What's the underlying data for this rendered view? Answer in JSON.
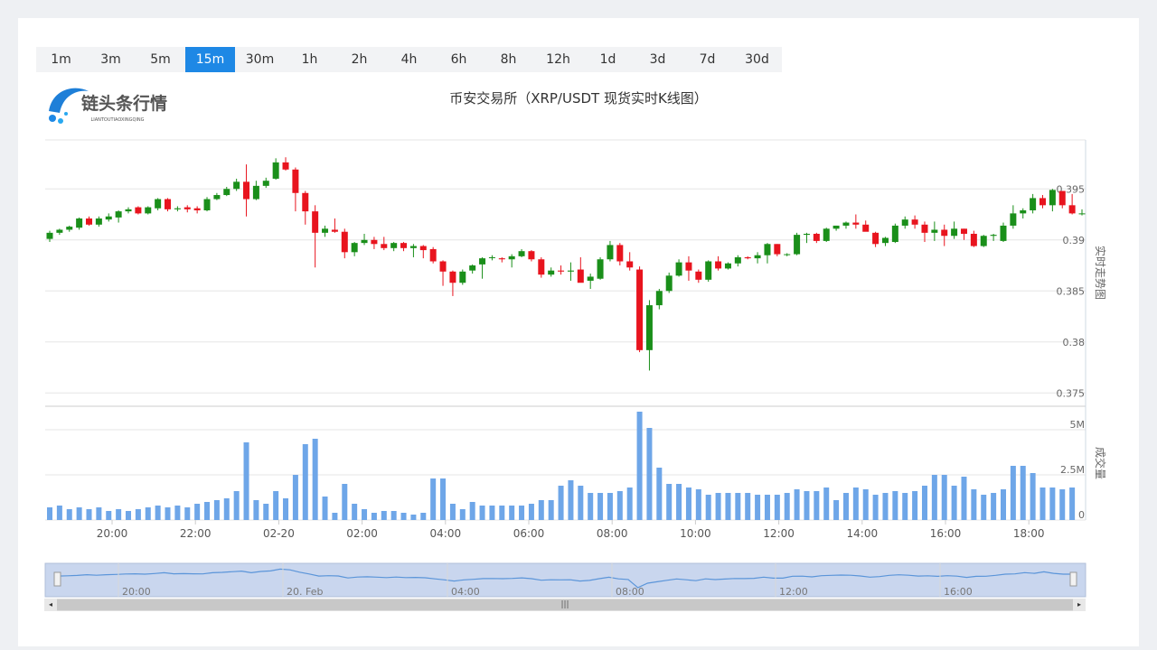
{
  "tabs": [
    {
      "label": "1m"
    },
    {
      "label": "3m"
    },
    {
      "label": "5m"
    },
    {
      "label": "15m",
      "active": true
    },
    {
      "label": "30m"
    },
    {
      "label": "1h"
    },
    {
      "label": "2h"
    },
    {
      "label": "4h"
    },
    {
      "label": "6h"
    },
    {
      "label": "8h"
    },
    {
      "label": "12h"
    },
    {
      "label": "1d"
    },
    {
      "label": "3d"
    },
    {
      "label": "7d"
    },
    {
      "label": "30d"
    }
  ],
  "logo": {
    "text": "链头条行情",
    "subtext": "LIANTOUTIAOXINGQING"
  },
  "title": "币安交易所（XRP/USDT 现货实时K线图）",
  "colors": {
    "up": "#1a8f1a",
    "down": "#e8141e",
    "volume": "#6ea6e8",
    "active_tab": "#1e88e5"
  },
  "chart_data": {
    "type": "candlestick",
    "price_axis": {
      "label": "实时走势图",
      "ticks": [
        "0.375",
        "0.38",
        "0.385",
        "0.39",
        "0.395"
      ],
      "ylim": [
        0.3737,
        0.3998
      ]
    },
    "volume_axis": {
      "label": "成交量",
      "ticks": [
        "0",
        "2.5M",
        "5M"
      ],
      "ylim": [
        0,
        6.3
      ]
    },
    "x_ticks": [
      "20:00",
      "22:00",
      "02-20",
      "02:00",
      "04:00",
      "06:00",
      "08:00",
      "10:00",
      "12:00",
      "14:00",
      "16:00",
      "18:00"
    ],
    "candles": [
      [
        0.3901,
        0.3909,
        0.3898,
        0.3907,
        0.7
      ],
      [
        0.3907,
        0.3911,
        0.3905,
        0.391,
        0.8
      ],
      [
        0.391,
        0.3914,
        0.3908,
        0.3913,
        0.6
      ],
      [
        0.3912,
        0.3922,
        0.391,
        0.3921,
        0.7
      ],
      [
        0.3921,
        0.3923,
        0.3914,
        0.3915,
        0.6
      ],
      [
        0.3915,
        0.3923,
        0.3913,
        0.3921,
        0.7
      ],
      [
        0.392,
        0.3926,
        0.3918,
        0.3923,
        0.5
      ],
      [
        0.3922,
        0.3929,
        0.3917,
        0.3928,
        0.6
      ],
      [
        0.3928,
        0.3932,
        0.3926,
        0.393,
        0.5
      ],
      [
        0.3932,
        0.3933,
        0.3925,
        0.3926,
        0.6
      ],
      [
        0.3926,
        0.3933,
        0.3925,
        0.3932,
        0.7
      ],
      [
        0.3931,
        0.3941,
        0.3929,
        0.394,
        0.8
      ],
      [
        0.394,
        0.3941,
        0.3928,
        0.393,
        0.7
      ],
      [
        0.393,
        0.3933,
        0.3928,
        0.3931,
        0.8
      ],
      [
        0.3932,
        0.3934,
        0.3927,
        0.393,
        0.7
      ],
      [
        0.3931,
        0.3933,
        0.3926,
        0.3929,
        0.9
      ],
      [
        0.3929,
        0.3942,
        0.3928,
        0.394,
        1.0
      ],
      [
        0.394,
        0.3946,
        0.3939,
        0.3944,
        1.1
      ],
      [
        0.3944,
        0.3952,
        0.3943,
        0.395,
        1.2
      ],
      [
        0.395,
        0.396,
        0.3948,
        0.3957,
        1.6
      ],
      [
        0.3957,
        0.3974,
        0.3923,
        0.394,
        4.3
      ],
      [
        0.394,
        0.3958,
        0.3939,
        0.3953,
        1.1
      ],
      [
        0.3953,
        0.3961,
        0.3951,
        0.3958,
        0.9
      ],
      [
        0.396,
        0.398,
        0.3959,
        0.3976,
        1.6
      ],
      [
        0.3976,
        0.3981,
        0.3968,
        0.3969,
        1.2
      ],
      [
        0.3969,
        0.3971,
        0.3928,
        0.3946,
        2.5
      ],
      [
        0.3946,
        0.3948,
        0.3915,
        0.3928,
        4.2
      ],
      [
        0.3928,
        0.3934,
        0.3873,
        0.3907,
        4.5
      ],
      [
        0.3907,
        0.3914,
        0.3903,
        0.3911,
        1.3
      ],
      [
        0.391,
        0.3921,
        0.3907,
        0.3908,
        0.4
      ],
      [
        0.3908,
        0.3911,
        0.3882,
        0.3888,
        2.0
      ],
      [
        0.3888,
        0.3898,
        0.3884,
        0.3897,
        0.9
      ],
      [
        0.3897,
        0.3906,
        0.3895,
        0.39,
        0.6
      ],
      [
        0.39,
        0.3903,
        0.3891,
        0.3896,
        0.4
      ],
      [
        0.3896,
        0.3903,
        0.389,
        0.3892,
        0.5
      ],
      [
        0.3892,
        0.3898,
        0.3889,
        0.3897,
        0.5
      ],
      [
        0.3897,
        0.3898,
        0.3889,
        0.3892,
        0.4
      ],
      [
        0.3892,
        0.3896,
        0.3883,
        0.3894,
        0.3
      ],
      [
        0.3894,
        0.3895,
        0.3882,
        0.389,
        0.4
      ],
      [
        0.3891,
        0.3893,
        0.3877,
        0.3879,
        2.3
      ],
      [
        0.3879,
        0.388,
        0.3855,
        0.3869,
        2.3
      ],
      [
        0.3869,
        0.387,
        0.3845,
        0.3858,
        0.9
      ],
      [
        0.3858,
        0.3871,
        0.3856,
        0.3869,
        0.6
      ],
      [
        0.387,
        0.3876,
        0.3867,
        0.3875,
        1.0
      ],
      [
        0.3876,
        0.3883,
        0.3862,
        0.3882,
        0.8
      ],
      [
        0.3883,
        0.3885,
        0.388,
        0.3883,
        0.8
      ],
      [
        0.3882,
        0.3883,
        0.3878,
        0.3881,
        0.8
      ],
      [
        0.3881,
        0.3886,
        0.3873,
        0.3884,
        0.8
      ],
      [
        0.3884,
        0.3891,
        0.3883,
        0.3889,
        0.8
      ],
      [
        0.3889,
        0.389,
        0.3879,
        0.3881,
        0.9
      ],
      [
        0.3881,
        0.3883,
        0.3863,
        0.3866,
        1.1
      ],
      [
        0.3866,
        0.3873,
        0.3864,
        0.387,
        1.1
      ],
      [
        0.387,
        0.3875,
        0.3866,
        0.3869,
        1.9
      ],
      [
        0.3869,
        0.3878,
        0.386,
        0.387,
        2.2
      ],
      [
        0.3871,
        0.3883,
        0.3862,
        0.3858,
        1.9
      ],
      [
        0.386,
        0.3867,
        0.3852,
        0.3864,
        1.5
      ],
      [
        0.3862,
        0.3883,
        0.3861,
        0.3881,
        1.5
      ],
      [
        0.3881,
        0.3899,
        0.3879,
        0.3895,
        1.5
      ],
      [
        0.3895,
        0.3897,
        0.3875,
        0.3879,
        1.6
      ],
      [
        0.3879,
        0.3888,
        0.387,
        0.3873,
        1.8
      ],
      [
        0.3871,
        0.3874,
        0.379,
        0.3792,
        6.0
      ],
      [
        0.3792,
        0.3841,
        0.3772,
        0.3836,
        5.1
      ],
      [
        0.3836,
        0.3852,
        0.3832,
        0.385,
        2.9
      ],
      [
        0.385,
        0.3868,
        0.3848,
        0.3865,
        2.0
      ],
      [
        0.3865,
        0.3881,
        0.3864,
        0.3878,
        2.0
      ],
      [
        0.3878,
        0.3884,
        0.386,
        0.387,
        1.8
      ],
      [
        0.3869,
        0.3871,
        0.3858,
        0.3861,
        1.7
      ],
      [
        0.3861,
        0.388,
        0.3859,
        0.3879,
        1.4
      ],
      [
        0.3879,
        0.3884,
        0.387,
        0.3872,
        1.5
      ],
      [
        0.3872,
        0.3878,
        0.3871,
        0.3877,
        1.5
      ],
      [
        0.3877,
        0.3885,
        0.3874,
        0.3883,
        1.5
      ],
      [
        0.3883,
        0.3884,
        0.3881,
        0.3882,
        1.5
      ],
      [
        0.3882,
        0.3888,
        0.3877,
        0.3885,
        1.4
      ],
      [
        0.3885,
        0.3897,
        0.3877,
        0.3896,
        1.4
      ],
      [
        0.3896,
        0.3896,
        0.3884,
        0.3886,
        1.4
      ],
      [
        0.3886,
        0.3887,
        0.3884,
        0.3886,
        1.5
      ],
      [
        0.3886,
        0.3907,
        0.3885,
        0.3905,
        1.7
      ],
      [
        0.3905,
        0.3907,
        0.3897,
        0.3906,
        1.6
      ],
      [
        0.3906,
        0.3907,
        0.3897,
        0.3899,
        1.6
      ],
      [
        0.3899,
        0.3912,
        0.3898,
        0.3911,
        1.8
      ],
      [
        0.3911,
        0.3914,
        0.3909,
        0.3914,
        1.1
      ],
      [
        0.3914,
        0.3918,
        0.3911,
        0.3917,
        1.5
      ],
      [
        0.3917,
        0.3925,
        0.3911,
        0.3915,
        1.8
      ],
      [
        0.3915,
        0.3919,
        0.3909,
        0.3908,
        1.7
      ],
      [
        0.3907,
        0.3908,
        0.3893,
        0.3896,
        1.4
      ],
      [
        0.3897,
        0.3903,
        0.3894,
        0.3902,
        1.5
      ],
      [
        0.3898,
        0.3916,
        0.3897,
        0.3914,
        1.6
      ],
      [
        0.3914,
        0.3923,
        0.3911,
        0.392,
        1.5
      ],
      [
        0.392,
        0.3924,
        0.3911,
        0.3915,
        1.6
      ],
      [
        0.3915,
        0.3918,
        0.3898,
        0.3907,
        1.9
      ],
      [
        0.3907,
        0.3918,
        0.3899,
        0.391,
        2.5
      ],
      [
        0.391,
        0.3915,
        0.3894,
        0.3904,
        2.5
      ],
      [
        0.3904,
        0.3918,
        0.3901,
        0.3911,
        1.9
      ],
      [
        0.3911,
        0.3911,
        0.39,
        0.3906,
        2.4
      ],
      [
        0.3906,
        0.3909,
        0.3893,
        0.3894,
        1.7
      ],
      [
        0.3894,
        0.3905,
        0.3893,
        0.3904,
        1.4
      ],
      [
        0.3904,
        0.3906,
        0.3899,
        0.3905,
        1.5
      ],
      [
        0.3899,
        0.3917,
        0.3898,
        0.3914,
        1.7
      ],
      [
        0.3914,
        0.3934,
        0.3911,
        0.3926,
        3.0
      ],
      [
        0.3926,
        0.3931,
        0.3921,
        0.3929,
        3.0
      ],
      [
        0.3929,
        0.3945,
        0.3926,
        0.3941,
        2.6
      ],
      [
        0.3941,
        0.3944,
        0.3931,
        0.3934,
        1.8
      ],
      [
        0.3934,
        0.395,
        0.3928,
        0.3949,
        1.8
      ],
      [
        0.3948,
        0.3946,
        0.3931,
        0.3934,
        1.7
      ],
      [
        0.3934,
        0.3945,
        0.3925,
        0.3926,
        1.8
      ],
      [
        0.3926,
        0.393,
        0.3924,
        0.3926,
        0.0
      ]
    ],
    "navigator": {
      "labels": [
        "20:00",
        "20. Feb",
        "04:00",
        "08:00",
        "12:00",
        "16:00"
      ]
    }
  }
}
